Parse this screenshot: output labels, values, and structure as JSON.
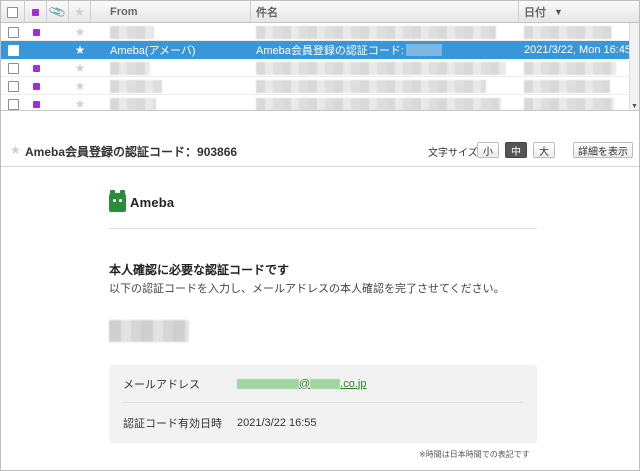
{
  "list": {
    "columns": {
      "from": "From",
      "subject": "件名",
      "date": "日付",
      "sort_indicator": "▼"
    },
    "rows": [
      {
        "selected": false,
        "from": "",
        "subject": "",
        "date": "",
        "blurred": true,
        "label_color": "#a030d0"
      },
      {
        "selected": true,
        "from": "Ameba(アメーバ)",
        "subject": "Ameba会員登録の認証コード:",
        "date": "2021/3/22, Mon 16:45",
        "blurred": false,
        "starred": true
      },
      {
        "selected": false,
        "from": "",
        "subject": "",
        "date": "",
        "blurred": true,
        "label_color": "#a030d0"
      },
      {
        "selected": false,
        "from": "",
        "subject": "",
        "date": "",
        "blurred": true,
        "label_color": "#a030d0"
      },
      {
        "selected": false,
        "from": "",
        "subject": "",
        "date": "",
        "blurred": true,
        "label_color": "#a030d0"
      }
    ]
  },
  "preview": {
    "title": "Ameba会員登録の認証コード：903866",
    "font_size_label": "文字サイズ:",
    "font_sizes": [
      "小",
      "中",
      "大"
    ],
    "selected_font_size": "中",
    "details_button": "詳細を表示"
  },
  "email": {
    "logo_text": "Ameba",
    "logo_color": "#2d8c3c",
    "headline": "本人確認に必要な認証コードです",
    "instruction": "以下の認証コードを入力し、メールアドレスの本人確認を完了させてください。",
    "info": {
      "email_label": "メールアドレス",
      "email_at": "@",
      "email_domain_suffix": ".co.jp",
      "expiry_label": "認証コード有効日時",
      "expiry_value": "2021/3/22 16:55"
    },
    "footnote": "※時間は日本時間での表記です"
  },
  "colors": {
    "selection": "#3a96d6",
    "label_purple": "#a030d0",
    "link_green": "#2a7d2a"
  }
}
